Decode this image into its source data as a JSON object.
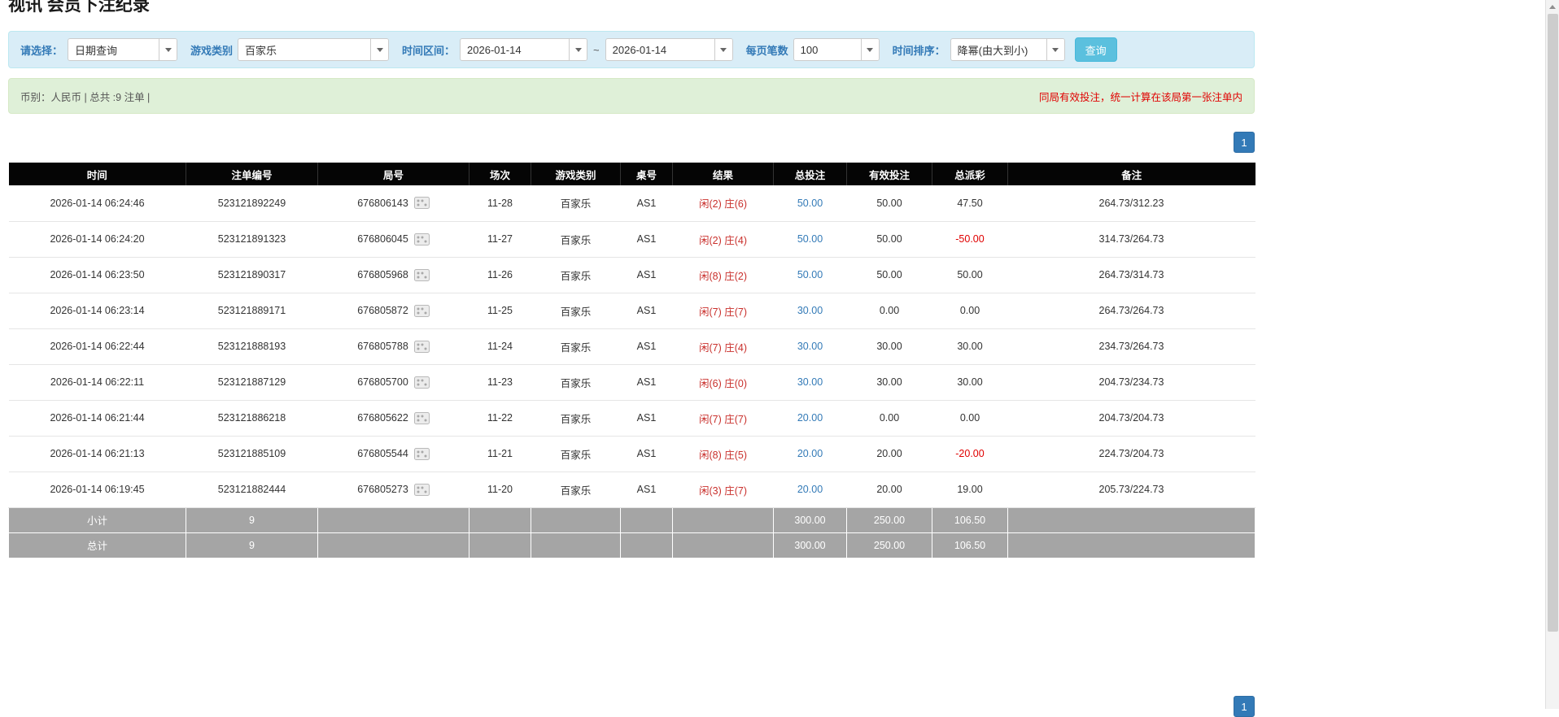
{
  "page": {
    "title": "视讯 会员下注纪录"
  },
  "colors": {
    "accent_blue": "#337ab7",
    "filter_bar_bg": "#d9edf7",
    "summary_bar_bg": "#dff0d8",
    "header_bg": "#050505",
    "footer_row_bg": "#a5a5a5",
    "notice_red": "#e00000",
    "search_button_bg": "#5bc0de"
  },
  "filters": {
    "query_type_label": "请选择：",
    "query_type_value": "日期查询",
    "game_type_label": "游戏类别",
    "game_type_value": "百家乐",
    "time_range_label": "时间区间：",
    "date_from": "2026-01-14",
    "range_separator": "~",
    "date_to": "2026-01-14",
    "page_size_label": "每页笔数",
    "page_size_value": "100",
    "sort_label": "时间排序：",
    "sort_value": "降幂(由大到小)",
    "search_button_label": "查询"
  },
  "summary": {
    "left_text": "币别：人民币 | 总共 :9 注单 |",
    "right_notice": "同局有效投注，统一计算在该局第一张注单内"
  },
  "pagination": {
    "current_page": "1"
  },
  "table": {
    "headers": [
      "时间",
      "注单编号",
      "局号",
      "场次",
      "游戏类别",
      "桌号",
      "结果",
      "总投注",
      "有效投注",
      "总派彩",
      "备注"
    ],
    "rows": [
      {
        "time": "2026-01-14 06:24:46",
        "bet_id": "523121892249",
        "round_id": "676806143",
        "session": "11-28",
        "game_type": "百家乐",
        "table_no": "AS1",
        "result_player": "闲(2)",
        "result_banker": "庄(6)",
        "total_bet": "50.00",
        "valid_bet": "50.00",
        "payout": "47.50",
        "note": "264.73/312.23"
      },
      {
        "time": "2026-01-14 06:24:20",
        "bet_id": "523121891323",
        "round_id": "676806045",
        "session": "11-27",
        "game_type": "百家乐",
        "table_no": "AS1",
        "result_player": "闲(2)",
        "result_banker": "庄(4)",
        "total_bet": "50.00",
        "valid_bet": "50.00",
        "payout": "-50.00",
        "note": "314.73/264.73"
      },
      {
        "time": "2026-01-14 06:23:50",
        "bet_id": "523121890317",
        "round_id": "676805968",
        "session": "11-26",
        "game_type": "百家乐",
        "table_no": "AS1",
        "result_player": "闲(8)",
        "result_banker": "庄(2)",
        "total_bet": "50.00",
        "valid_bet": "50.00",
        "payout": "50.00",
        "note": "264.73/314.73"
      },
      {
        "time": "2026-01-14 06:23:14",
        "bet_id": "523121889171",
        "round_id": "676805872",
        "session": "11-25",
        "game_type": "百家乐",
        "table_no": "AS1",
        "result_player": "闲(7)",
        "result_banker": "庄(7)",
        "total_bet": "30.00",
        "valid_bet": "0.00",
        "payout": "0.00",
        "note": "264.73/264.73"
      },
      {
        "time": "2026-01-14 06:22:44",
        "bet_id": "523121888193",
        "round_id": "676805788",
        "session": "11-24",
        "game_type": "百家乐",
        "table_no": "AS1",
        "result_player": "闲(7)",
        "result_banker": "庄(4)",
        "total_bet": "30.00",
        "valid_bet": "30.00",
        "payout": "30.00",
        "note": "234.73/264.73"
      },
      {
        "time": "2026-01-14 06:22:11",
        "bet_id": "523121887129",
        "round_id": "676805700",
        "session": "11-23",
        "game_type": "百家乐",
        "table_no": "AS1",
        "result_player": "闲(6)",
        "result_banker": "庄(0)",
        "total_bet": "30.00",
        "valid_bet": "30.00",
        "payout": "30.00",
        "note": "204.73/234.73"
      },
      {
        "time": "2026-01-14 06:21:44",
        "bet_id": "523121886218",
        "round_id": "676805622",
        "session": "11-22",
        "game_type": "百家乐",
        "table_no": "AS1",
        "result_player": "闲(7)",
        "result_banker": "庄(7)",
        "total_bet": "20.00",
        "valid_bet": "0.00",
        "payout": "0.00",
        "note": "204.73/204.73"
      },
      {
        "time": "2026-01-14 06:21:13",
        "bet_id": "523121885109",
        "round_id": "676805544",
        "session": "11-21",
        "game_type": "百家乐",
        "table_no": "AS1",
        "result_player": "闲(8)",
        "result_banker": "庄(5)",
        "total_bet": "20.00",
        "valid_bet": "20.00",
        "payout": "-20.00",
        "note": "224.73/204.73"
      },
      {
        "time": "2026-01-14 06:19:45",
        "bet_id": "523121882444",
        "round_id": "676805273",
        "session": "11-20",
        "game_type": "百家乐",
        "table_no": "AS1",
        "result_player": "闲(3)",
        "result_banker": "庄(7)",
        "total_bet": "20.00",
        "valid_bet": "20.00",
        "payout": "19.00",
        "note": "205.73/224.73"
      }
    ],
    "subtotal": {
      "label": "小计",
      "count": "9",
      "total_bet": "300.00",
      "valid_bet": "250.00",
      "payout": "106.50"
    },
    "total": {
      "label": "总计",
      "count": "9",
      "total_bet": "300.00",
      "valid_bet": "250.00",
      "payout": "106.50"
    }
  }
}
